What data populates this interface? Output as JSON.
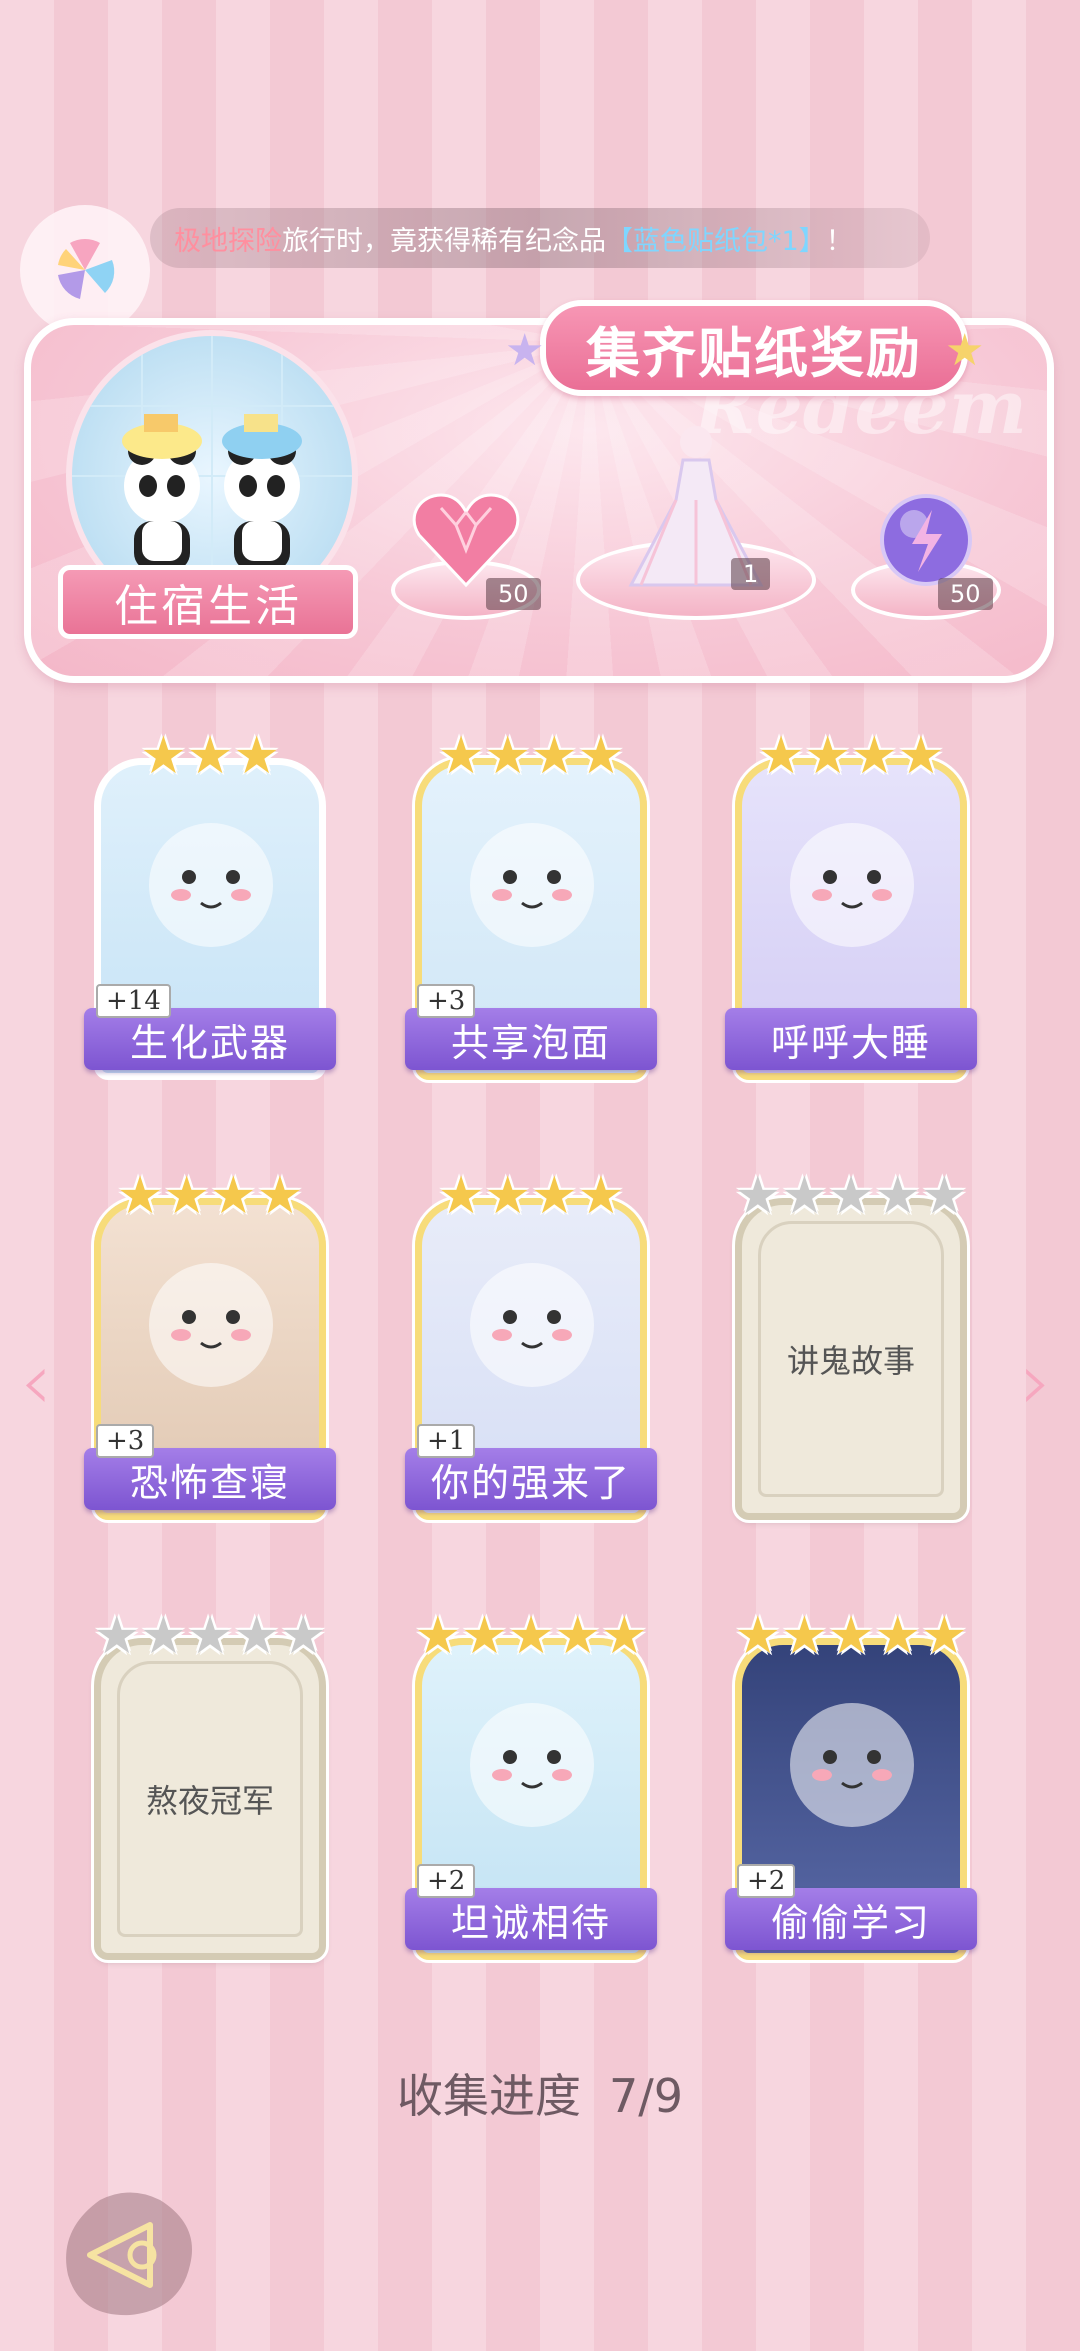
{
  "ticker": {
    "place": "极地探险",
    "mid": "旅行时，竟获得稀有纪念品",
    "item": "【蓝色贴纸包*1】",
    "end": "！"
  },
  "reward": {
    "title": "集齐贴纸奖励",
    "watermark": "Redeem",
    "theme_label": "住宿生活",
    "items": [
      {
        "name": "heart-gem",
        "count": "50"
      },
      {
        "name": "dress",
        "count": "1"
      },
      {
        "name": "energy-orb",
        "count": "50"
      }
    ]
  },
  "cards": [
    {
      "title": "生化武器",
      "plus": "+14",
      "stars": 3,
      "collected": true
    },
    {
      "title": "共享泡面",
      "plus": "+3",
      "stars": 4,
      "collected": true
    },
    {
      "title": "呼呼大睡",
      "plus": "",
      "stars": 4,
      "collected": true
    },
    {
      "title": "恐怖查寝",
      "plus": "+3",
      "stars": 4,
      "collected": true
    },
    {
      "title": "你的强来了",
      "plus": "+1",
      "stars": 4,
      "collected": true
    },
    {
      "title": "讲鬼故事",
      "plus": "",
      "stars": 5,
      "collected": false
    },
    {
      "title": "熬夜冠军",
      "plus": "",
      "stars": 5,
      "collected": false
    },
    {
      "title": "坦诚相待",
      "plus": "+2",
      "stars": 5,
      "collected": true
    },
    {
      "title": "偷偷学习",
      "plus": "+2",
      "stars": 5,
      "collected": true
    }
  ],
  "progress": {
    "label": "收集进度",
    "value": "7/9"
  },
  "colors": {
    "accent_pink": "#ea6f96",
    "banner_purple": "#7d55d1",
    "star_gold": "#f5c84c"
  }
}
